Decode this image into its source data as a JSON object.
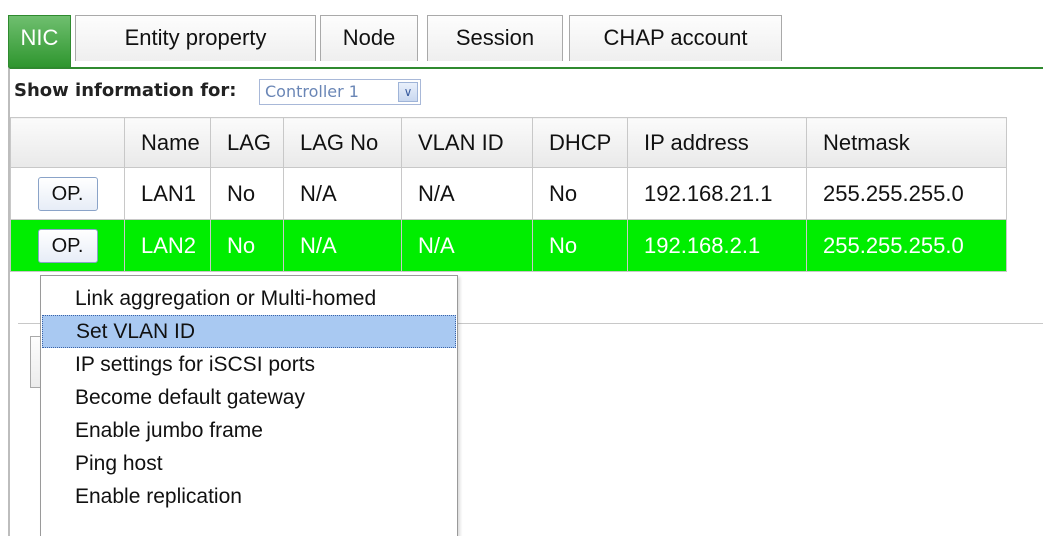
{
  "tabs": [
    {
      "label": "NIC",
      "active": true
    },
    {
      "label": "Entity property",
      "active": false
    },
    {
      "label": "Node",
      "active": false
    },
    {
      "label": "Session",
      "active": false
    },
    {
      "label": "CHAP account",
      "active": false
    }
  ],
  "filter": {
    "label": "Show information for:",
    "selected": "Controller 1"
  },
  "table": {
    "columns": [
      "",
      "Name",
      "LAG",
      "LAG No",
      "VLAN ID",
      "DHCP",
      "IP address",
      "Netmask"
    ],
    "rows": [
      {
        "op": "OP.",
        "name": "LAN1",
        "lag": "No",
        "lag_no": "N/A",
        "vlan_id": "N/A",
        "dhcp": "No",
        "ip": "192.168.21.1",
        "netmask": "255.255.255.0",
        "selected": false
      },
      {
        "op": "OP.",
        "name": "LAN2",
        "lag": "No",
        "lag_no": "N/A",
        "vlan_id": "N/A",
        "dhcp": "No",
        "ip": "192.168.2.1",
        "netmask": "255.255.255.0",
        "selected": true
      }
    ]
  },
  "menu": {
    "items": [
      "Link aggregation or Multi-homed",
      "Set VLAN ID",
      "IP settings for iSCSI ports",
      "Become default gateway",
      "Enable jumbo frame",
      "Ping host",
      "Enable replication"
    ],
    "highlighted": "Set VLAN ID"
  },
  "colors": {
    "active_tab": "#2f962f",
    "selected_row": "#00ee00",
    "menu_highlight": "#a9c9f2"
  }
}
